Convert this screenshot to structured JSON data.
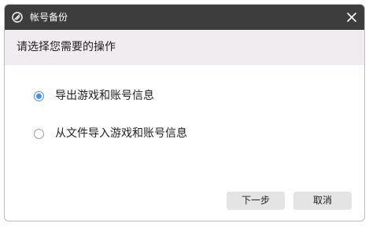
{
  "window": {
    "title": "帐号备份",
    "close_icon": "close-icon",
    "app_icon": "app-logo-icon"
  },
  "header": {
    "prompt": "请选择您需要的操作"
  },
  "options": [
    {
      "label": "导出游戏和账号信息",
      "selected": true
    },
    {
      "label": "从文件导入游戏和账号信息",
      "selected": false
    }
  ],
  "buttons": {
    "next": "下一步",
    "cancel": "取消"
  },
  "colors": {
    "titlebar": "#3d3d3d",
    "header_band": "#f1ecef",
    "radio_selected": "#4a90e2",
    "button_bg": "#e4e4e4"
  }
}
